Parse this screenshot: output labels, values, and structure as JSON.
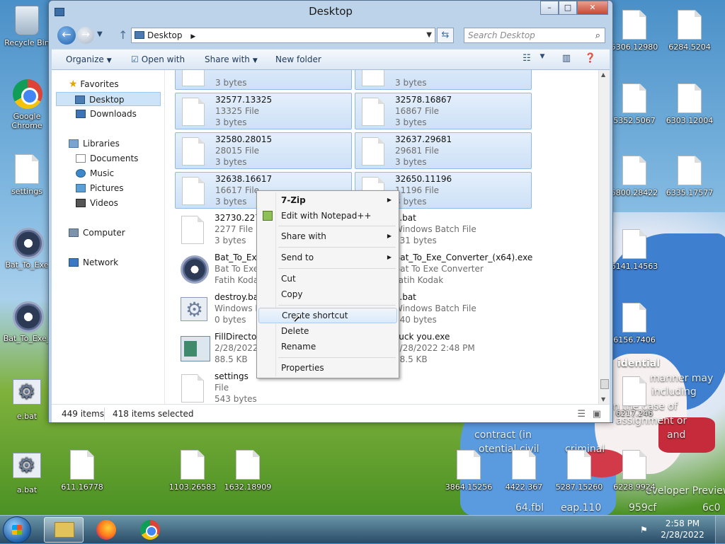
{
  "window": {
    "title": "Desktop",
    "address": "Desktop",
    "search_placeholder": "Search Desktop",
    "toolbar": {
      "organize": "Organize",
      "open_with": "Open with",
      "share_with": "Share with",
      "new_folder": "New folder"
    },
    "nav": {
      "favorites": "Favorites",
      "desktop": "Desktop",
      "downloads": "Downloads",
      "libraries": "Libraries",
      "documents": "Documents",
      "music": "Music",
      "pictures": "Pictures",
      "videos": "Videos",
      "computer": "Computer",
      "network": "Network"
    },
    "files": [
      {
        "name": "",
        "type": "",
        "size": "3 bytes",
        "icon": "file-icon",
        "selected": true
      },
      {
        "name": "",
        "type": "",
        "size": "3 bytes",
        "icon": "file-icon",
        "selected": true
      },
      {
        "name": "32577.13325",
        "type": "13325 File",
        "size": "3 bytes",
        "icon": "file-icon",
        "selected": true
      },
      {
        "name": "32578.16867",
        "type": "16867 File",
        "size": "3 bytes",
        "icon": "file-icon",
        "selected": true
      },
      {
        "name": "32580.28015",
        "type": "28015 File",
        "size": "3 bytes",
        "icon": "file-icon",
        "selected": true
      },
      {
        "name": "32637.29681",
        "type": "29681 File",
        "size": "3 bytes",
        "icon": "file-icon",
        "selected": true
      },
      {
        "name": "32638.16617",
        "type": "16617 File",
        "size": "3 bytes",
        "icon": "file-icon",
        "selected": true
      },
      {
        "name": "32650.11196",
        "type": "11196 File",
        "size": "3 bytes",
        "icon": "file-icon",
        "selected": true
      },
      {
        "name": "32730.2277",
        "type": "2277 File",
        "size": "3 bytes",
        "icon": "file-icon",
        "selected": false
      },
      {
        "name": "a.bat",
        "type": "Windows Batch File",
        "size": "331 bytes",
        "icon": "batch-file-icon",
        "selected": false
      },
      {
        "name": "Bat_To_Exe",
        "type": "Bat To Exe",
        "size": "Fatih Kodak",
        "icon": "gear-icon",
        "selected": false
      },
      {
        "name": "Bat_To_Exe_Converter_(x64).exe",
        "type": "Bat To Exe Converter",
        "size": "Fatih Kodak",
        "icon": "gear-icon",
        "selected": false
      },
      {
        "name": "destroy.bat",
        "type": "Windows B",
        "size": "0 bytes",
        "icon": "batch-file-icon",
        "selected": false
      },
      {
        "name": "e.bat",
        "type": "Windows Batch File",
        "size": "240 bytes",
        "icon": "batch-file-icon",
        "selected": false
      },
      {
        "name": "FillDirector",
        "type": "2/28/2022",
        "size": "88.5 KB",
        "icon": "app-icon",
        "selected": false
      },
      {
        "name": "Fuck you.exe",
        "type": "2/28/2022 2:48 PM",
        "size": "88.5 KB",
        "icon": "app-icon",
        "selected": false
      },
      {
        "name": "settings",
        "type": "File",
        "size": "543 bytes",
        "icon": "file-icon",
        "selected": false
      }
    ],
    "status": {
      "items": "449 items",
      "selected": "418 items selected"
    }
  },
  "context_menu": {
    "items": [
      {
        "label": "7-Zip",
        "bold": true,
        "submenu": true
      },
      {
        "label": "Edit with Notepad++",
        "icon": "notepad-icon"
      },
      {
        "label": "Share with",
        "submenu": true
      },
      {
        "label": "Send to",
        "submenu": true
      },
      {
        "label": "Cut"
      },
      {
        "label": "Copy"
      },
      {
        "label": "Create shortcut",
        "highlighted": true
      },
      {
        "label": "Delete"
      },
      {
        "label": "Rename"
      },
      {
        "label": "Properties"
      }
    ]
  },
  "desktop_icons": {
    "recycle_bin": "Recycle Bin",
    "google_chrome": "Google Chrome",
    "settings": "settings",
    "bat_to_exe_1": "Bat_To_Exe",
    "bat_to_exe_2": "Bat_To_Exe_",
    "e_bat": "e.bat",
    "a_bat": "a.bat",
    "f611": "611.16778",
    "f1103": "1103.26583",
    "f1632": "1632.18909",
    "f3864": "3864.15256",
    "f4422": "4422.367",
    "f5287": "5287.15260",
    "f6228": "6228.9924",
    "f5306": "5306.12980",
    "f6284": "6284.5204",
    "f5352": "5352.5067",
    "f6303": "6303.12004",
    "f5800": "5800.28422",
    "f6335": "6335.17577",
    "f6141": "6141.14563",
    "f6156": "6156.7406",
    "f6217": "6217.246"
  },
  "wallpaper_text": [
    "idential",
    "manner may",
    "including",
    "n the case of",
    "assignment or",
    "contract (in",
    "and",
    "otential civil",
    "criminal",
    "eveloper Preview",
    "64.fbl",
    "eap.110",
    "959cf",
    "6c0"
  ],
  "taskbar": {
    "time": "2:58 PM",
    "date": "2/28/2022"
  }
}
